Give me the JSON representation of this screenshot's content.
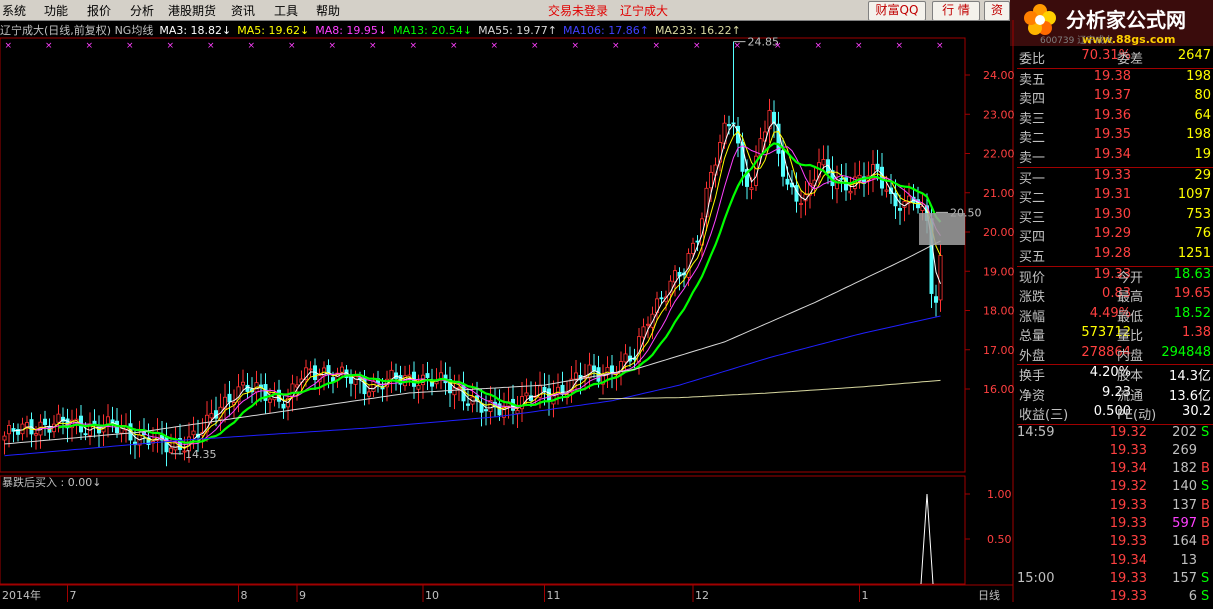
{
  "menu": {
    "items": [
      "系统",
      "功能",
      "报价",
      "分析",
      "港股期货",
      "资讯",
      "工具",
      "帮助"
    ],
    "status": "交易未登录",
    "stock_link": "辽宁成大",
    "buttons": [
      "财富QQ",
      "行 情",
      "资"
    ]
  },
  "logo": {
    "title": "分析家公式网",
    "url_text": "www.88gs.com",
    "code_text": "600739 辽宁成大"
  },
  "ma_line": [
    {
      "text": "辽宁成大(日线,前复权) NG均线",
      "color": "#c0c0c0"
    },
    {
      "text": "MA3: 18.82↓",
      "color": "#ffffff"
    },
    {
      "text": "MA5: 19.62↓",
      "color": "#ffff00"
    },
    {
      "text": "MA8: 19.95↓",
      "color": "#ff40ff"
    },
    {
      "text": "MA13: 20.54↓",
      "color": "#00ff00"
    },
    {
      "text": "MA55: 19.77↑",
      "color": "#d8d8d8"
    },
    {
      "text": "MA106: 17.86↑",
      "color": "#4040ff"
    },
    {
      "text": "MA233: 16.22↑",
      "color": "#d8d8a0"
    }
  ],
  "sub_title": "暴跌后买入 : 0.00↓",
  "bottom": {
    "year": "2014年",
    "period_label": "日线"
  },
  "chart_data": [
    {
      "type": "candlestick",
      "title": "辽宁成大(日线,前复权)",
      "y_ticks": [
        16.0,
        17.0,
        18.0,
        19.0,
        20.0,
        21.0,
        22.0,
        23.0,
        24.0
      ],
      "ylim": [
        14.0,
        25.0
      ],
      "x_month_labels": [
        {
          "label": "7",
          "idx": 14
        },
        {
          "label": "8",
          "idx": 52
        },
        {
          "label": "9",
          "idx": 65
        },
        {
          "label": "10",
          "idx": 93
        },
        {
          "label": "11",
          "idx": 120
        },
        {
          "label": "12",
          "idx": 153
        },
        {
          "label": "1",
          "idx": 190
        }
      ],
      "annotations": [
        {
          "text": "24.85",
          "idx": 162,
          "value": 24.85
        },
        {
          "text": "14.35",
          "idx": 37,
          "value": 14.35
        },
        {
          "text": "20.50",
          "idx": 207,
          "value": 20.5
        }
      ],
      "anchors": [
        [
          0,
          14.8
        ],
        [
          8,
          15.1
        ],
        [
          15,
          15.1
        ],
        [
          25,
          15.0
        ],
        [
          32,
          14.7
        ],
        [
          37,
          14.5
        ],
        [
          44,
          14.9
        ],
        [
          48,
          15.6
        ],
        [
          52,
          16.0
        ],
        [
          58,
          15.9
        ],
        [
          63,
          15.7
        ],
        [
          66,
          16.3
        ],
        [
          70,
          16.5
        ],
        [
          75,
          16.3
        ],
        [
          80,
          16.1
        ],
        [
          86,
          16.2
        ],
        [
          92,
          16.3
        ],
        [
          98,
          16.1
        ],
        [
          102,
          15.9
        ],
        [
          107,
          15.4
        ],
        [
          112,
          15.6
        ],
        [
          118,
          15.8
        ],
        [
          124,
          16.0
        ],
        [
          130,
          16.4
        ],
        [
          136,
          16.5
        ],
        [
          140,
          16.8
        ],
        [
          143,
          17.9
        ],
        [
          147,
          18.5
        ],
        [
          151,
          19.0
        ],
        [
          154,
          20.0
        ],
        [
          157,
          21.5
        ],
        [
          160,
          22.5
        ],
        [
          162,
          22.9
        ],
        [
          164,
          21.5
        ],
        [
          166,
          21.3
        ],
        [
          168,
          22.3
        ],
        [
          170,
          23.0
        ],
        [
          172,
          22.0
        ],
        [
          174,
          21.2
        ],
        [
          178,
          20.8
        ],
        [
          181,
          21.7
        ],
        [
          184,
          21.4
        ],
        [
          188,
          21.2
        ],
        [
          191,
          21.3
        ],
        [
          194,
          21.6
        ],
        [
          197,
          20.9
        ],
        [
          200,
          20.6
        ],
        [
          202,
          20.8
        ],
        [
          205,
          20.3
        ],
        [
          206,
          18.7
        ],
        [
          207,
          18.3
        ],
        [
          208,
          19.3
        ]
      ],
      "ma_lines": [
        {
          "name": "MA3",
          "period": 3,
          "color": "#ffffff",
          "value": 18.82
        },
        {
          "name": "MA5",
          "period": 5,
          "color": "#ffff00",
          "value": 19.62
        },
        {
          "name": "MA8",
          "period": 8,
          "color": "#ff40ff",
          "value": 19.95
        },
        {
          "name": "MA13",
          "period": 13,
          "color": "#00ff00",
          "value": 20.54
        },
        {
          "name": "MA55",
          "color": "#d8d8d8",
          "value": 19.77,
          "points": [
            [
              0,
              14.6
            ],
            [
              30,
              14.9
            ],
            [
              60,
              15.4
            ],
            [
              90,
              15.9
            ],
            [
              120,
              16.1
            ],
            [
              140,
              16.5
            ],
            [
              160,
              17.2
            ],
            [
              180,
              18.2
            ],
            [
              200,
              19.3
            ],
            [
              208,
              19.77
            ]
          ]
        },
        {
          "name": "MA106",
          "color": "#2020ff",
          "value": 17.86,
          "points": [
            [
              0,
              14.3
            ],
            [
              40,
              14.7
            ],
            [
              80,
              15.0
            ],
            [
              110,
              15.3
            ],
            [
              135,
              15.7
            ],
            [
              150,
              16.1
            ],
            [
              170,
              16.8
            ],
            [
              190,
              17.4
            ],
            [
              208,
              17.86
            ]
          ]
        },
        {
          "name": "MA233",
          "color": "#d8d8a0",
          "value": 16.22,
          "points": [
            [
              132,
              15.75
            ],
            [
              150,
              15.78
            ],
            [
              170,
              15.9
            ],
            [
              190,
              16.05
            ],
            [
              208,
              16.22
            ]
          ]
        }
      ]
    },
    {
      "type": "line",
      "title": "暴跌后买入",
      "y_ticks": [
        0.5,
        1.0
      ],
      "ylim": [
        0,
        1.2
      ],
      "values_nonzero": [
        {
          "idx": 205,
          "value": 1.0
        }
      ],
      "last_value": 0.0
    }
  ],
  "quote": {
    "header": [
      {
        "label": "委比",
        "value": "70.31%",
        "label2": "委差",
        "value2": "2647"
      }
    ],
    "asks": [
      {
        "label": "卖五",
        "price": "19.38",
        "vol": "198"
      },
      {
        "label": "卖四",
        "price": "19.37",
        "vol": "80"
      },
      {
        "label": "卖三",
        "price": "19.36",
        "vol": "64"
      },
      {
        "label": "卖二",
        "price": "19.35",
        "vol": "198"
      },
      {
        "label": "卖一",
        "price": "19.34",
        "vol": "19"
      }
    ],
    "bids": [
      {
        "label": "买一",
        "price": "19.33",
        "vol": "29"
      },
      {
        "label": "买二",
        "price": "19.31",
        "vol": "1097"
      },
      {
        "label": "买三",
        "price": "19.30",
        "vol": "753"
      },
      {
        "label": "买四",
        "price": "19.29",
        "vol": "76"
      },
      {
        "label": "买五",
        "price": "19.28",
        "vol": "1251"
      }
    ],
    "stats": [
      {
        "l1": "现价",
        "v1": "19.33",
        "c1": "#ff4040",
        "l2": "今开",
        "v2": "18.63",
        "c2": "#00ff00"
      },
      {
        "l1": "涨跌",
        "v1": "0.83",
        "c1": "#ff4040",
        "l2": "最高",
        "v2": "19.65",
        "c2": "#ff4040"
      },
      {
        "l1": "涨幅",
        "v1": "4.49%",
        "c1": "#ff4040",
        "l2": "最低",
        "v2": "18.52",
        "c2": "#00ff00"
      },
      {
        "l1": "总量",
        "v1": "573712",
        "c1": "#ffff00",
        "l2": "量比",
        "v2": "1.38",
        "c2": "#ff4040"
      },
      {
        "l1": "外盘",
        "v1": "278864",
        "c1": "#ff4040",
        "l2": "内盘",
        "v2": "294848",
        "c2": "#00ff00"
      }
    ],
    "stats2": [
      {
        "l1": "换手",
        "v1": "4.20%",
        "l2": "股本",
        "v2": "14.3亿"
      },
      {
        "l1": "净资",
        "v1": "9.23",
        "l2": "流通",
        "v2": "13.6亿"
      },
      {
        "l1": "收益(三)",
        "v1": "0.500",
        "l2": "PE(动)",
        "v2": "30.2"
      }
    ],
    "ticks": [
      {
        "time": "14:59",
        "price": "19.32",
        "vol": "202",
        "dir": "S",
        "vc": "#c0c0c0"
      },
      {
        "time": "",
        "price": "19.33",
        "vol": "269",
        "dir": "",
        "vc": "#c0c0c0"
      },
      {
        "time": "",
        "price": "19.34",
        "vol": "182",
        "dir": "B",
        "vc": "#c0c0c0"
      },
      {
        "time": "",
        "price": "19.32",
        "vol": "140",
        "dir": "S",
        "vc": "#c0c0c0"
      },
      {
        "time": "",
        "price": "19.33",
        "vol": "137",
        "dir": "B",
        "vc": "#c0c0c0"
      },
      {
        "time": "",
        "price": "19.33",
        "vol": "597",
        "dir": "B",
        "vc": "#ff40ff"
      },
      {
        "time": "",
        "price": "19.33",
        "vol": "164",
        "dir": "B",
        "vc": "#c0c0c0"
      },
      {
        "time": "",
        "price": "19.34",
        "vol": "13",
        "dir": "",
        "vc": "#c0c0c0"
      },
      {
        "time": "15:00",
        "price": "19.33",
        "vol": "157",
        "dir": "S",
        "vc": "#c0c0c0"
      },
      {
        "time": "",
        "price": "19.33",
        "vol": "6",
        "dir": "S",
        "vc": "#c0c0c0"
      }
    ]
  }
}
